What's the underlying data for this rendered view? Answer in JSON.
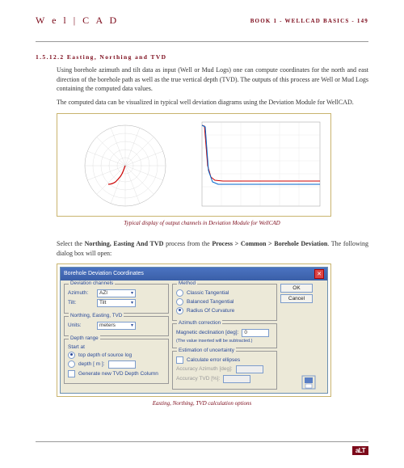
{
  "header": {
    "logo": "W e l | C A D",
    "book": "BOOK 1 - WELLCAD BASICS - 149"
  },
  "section": {
    "num": "1.5.12.2 Easting, Northing and TVD",
    "p1": "Using borehole azimuth and tilt data as input (Well or Mud Logs) one can compute coordinates for the north and east direction of the borehole path as well as the true vertical depth (TVD). The outputs of this process are Well or Mud Logs containing the computed data values.",
    "p2": "The computed data can be visualized in typical well deviation diagrams using the Deviation Module for WellCAD.",
    "caption1": "Typical display of output channels in Deviation Module for WellCAD",
    "p3a": "Select the ",
    "p3b": "Northing, Easting And TVD",
    "p3c": " process from the ",
    "p3d": "Process > Common > Borehole Deviation",
    "p3e": ". The following dialog box will open:",
    "caption2": "Easting, Northing, TVD calculation options"
  },
  "dlg": {
    "title": "Borehole Deviation Coordinates",
    "grp_dev": "Deviation channels",
    "azimuth_lbl": "Azimuth:",
    "azimuth_val": "AZI",
    "tilt_lbl": "Tilt:",
    "tilt_val": "Tilt",
    "grp_net": "Northing, Easting, TVD",
    "units_lbl": "Units:",
    "units_val": "meters",
    "grp_depth": "Depth range",
    "start_lbl": "Start at",
    "r_top": "top depth of source log",
    "r_depth": "depth  [ m ]:",
    "gen_tvd": "Generate new TVD Depth Column",
    "grp_method": "Method",
    "m1": "Classic Tangential",
    "m2": "Balanced Tangential",
    "m3": "Radius Of Curvature",
    "grp_ac": "Azimuth correction",
    "mag_lbl": "Magnetic declination [deg]:",
    "mag_val": "0",
    "mag_note": "(The value inserted will be subtracted.)",
    "grp_unc": "Estimation of uncertainty",
    "calc_err": "Calculate error ellipses",
    "acc_az": "Accuracy Azimuth [deg]:",
    "acc_tvd": "Accuracy TVD [%]:",
    "ok": "OK",
    "cancel": "Cancel"
  },
  "footer": "aLT"
}
